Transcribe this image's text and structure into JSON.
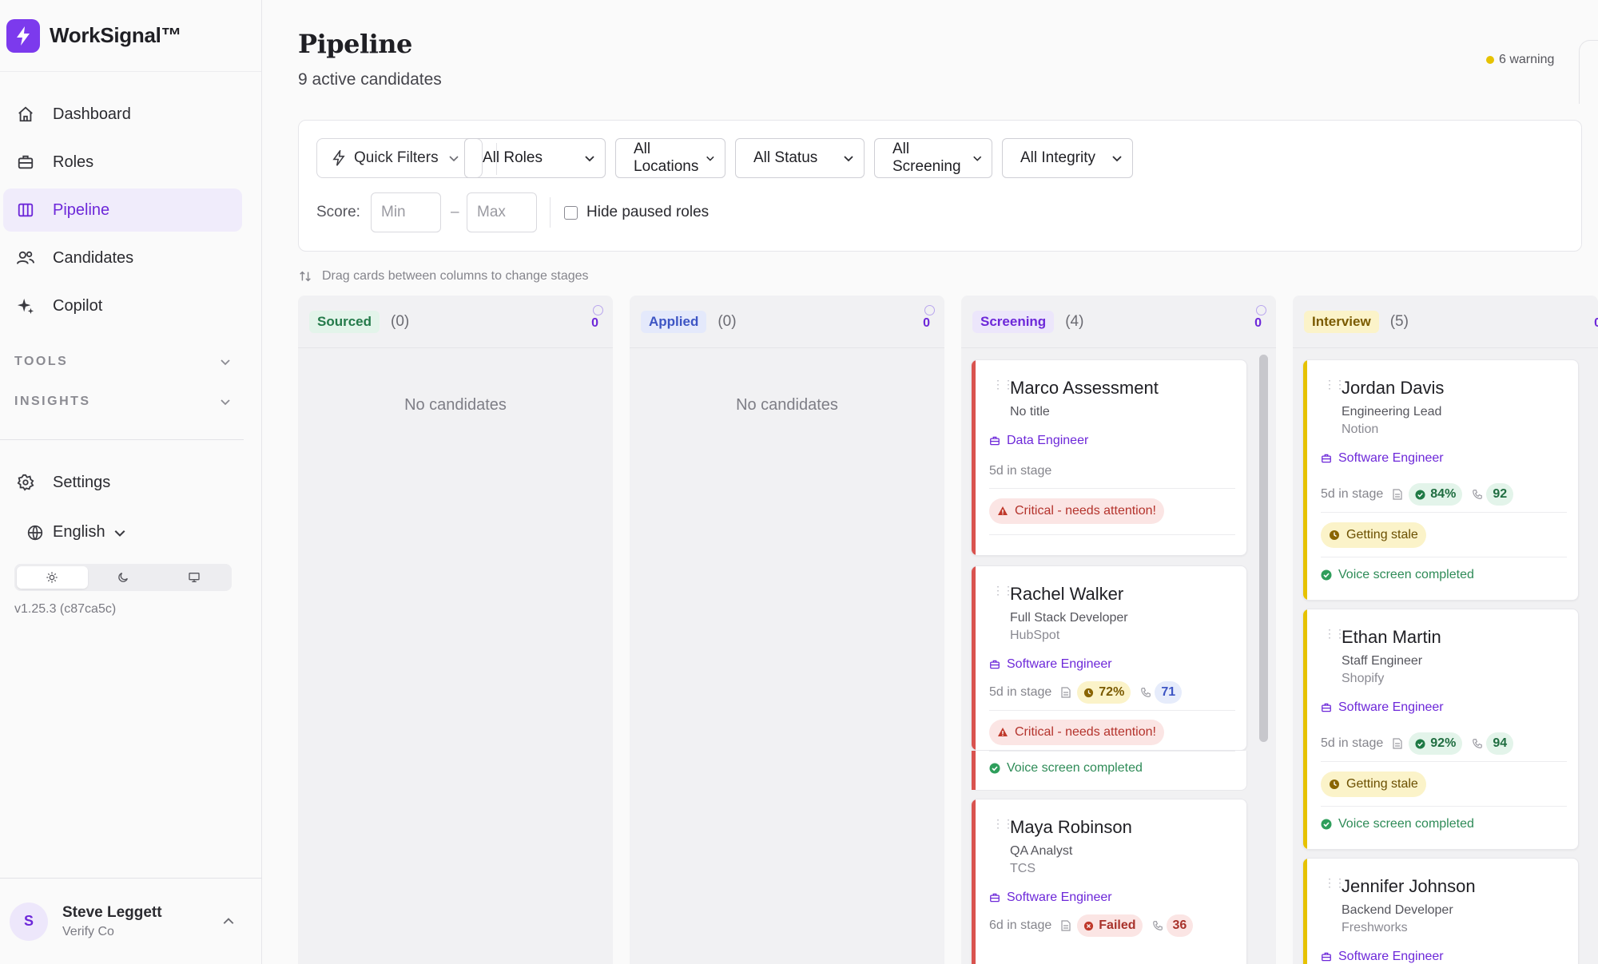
{
  "app": {
    "name": "WorkSignal™"
  },
  "sidebar": {
    "nav": [
      {
        "label": "Dashboard",
        "icon": "home-icon"
      },
      {
        "label": "Roles",
        "icon": "briefcase-icon"
      },
      {
        "label": "Pipeline",
        "icon": "columns-icon",
        "active": true
      },
      {
        "label": "Candidates",
        "icon": "users-icon"
      },
      {
        "label": "Copilot",
        "icon": "sparkles-icon"
      }
    ],
    "sections": [
      {
        "label": "TOOLS"
      },
      {
        "label": "INSIGHTS"
      }
    ],
    "settings_label": "Settings",
    "language": "English",
    "version": "v1.25.3 (c87ca5c)",
    "user": {
      "initial": "S",
      "name": "Steve Leggett",
      "org": "Verify Co"
    }
  },
  "header": {
    "title": "Pipeline",
    "subtitle": "9 active candidates",
    "warning": "6 warning"
  },
  "filters": {
    "quick_filters": "Quick Filters",
    "selects": [
      "All Roles",
      "All Locations",
      "All Status",
      "All Screening",
      "All Integrity"
    ],
    "score_label": "Score:",
    "min_placeholder": "Min",
    "max_placeholder": "Max",
    "score_dash": "–",
    "hide_paused": "Hide paused roles"
  },
  "hint": "Drag cards between columns to change stages",
  "columns": [
    {
      "name": "Sourced",
      "count": "(0)",
      "badge_count": "0",
      "empty": "No candidates"
    },
    {
      "name": "Applied",
      "count": "(0)",
      "badge_count": "0",
      "empty": "No candidates"
    },
    {
      "name": "Screening",
      "count": "(4)",
      "badge_count": "0"
    },
    {
      "name": "Interview",
      "count": "(5)",
      "badge_count": "0"
    }
  ],
  "screening_cards": [
    {
      "name": "Marco Assessment",
      "title": "No title",
      "role": "Data Engineer",
      "stage_time": "5d in stage",
      "alert": "Critical - needs attention!"
    },
    {
      "name": "Rachel Walker",
      "title": "Full Stack Developer",
      "company": "HubSpot",
      "role": "Software Engineer",
      "stage_time": "5d in stage",
      "score": "72%",
      "call": "71",
      "alert": "Critical - needs attention!",
      "status": "Voice screen completed"
    },
    {
      "name": "Maya Robinson",
      "title": "QA Analyst",
      "company": "TCS",
      "role": "Software Engineer",
      "stage_time": "6d in stage",
      "score": "Failed",
      "call": "36"
    }
  ],
  "interview_cards": [
    {
      "name": "Jordan Davis",
      "title": "Engineering Lead",
      "company": "Notion",
      "role": "Software Engineer",
      "stage_time": "5d in stage",
      "score": "84%",
      "call": "92",
      "alert": "Getting stale",
      "status": "Voice screen completed"
    },
    {
      "name": "Ethan Martin",
      "title": "Staff Engineer",
      "company": "Shopify",
      "role": "Software Engineer",
      "stage_time": "5d in stage",
      "score": "92%",
      "call": "94",
      "alert": "Getting stale",
      "status": "Voice screen completed"
    },
    {
      "name": "Jennifer Johnson",
      "title": "Backend Developer",
      "company": "Freshworks",
      "role": "Software Engineer"
    }
  ],
  "colors": {
    "accent": "#6d28d9",
    "critical": "#d9534f",
    "stale": "#e6c200",
    "success": "#2e8b57"
  }
}
